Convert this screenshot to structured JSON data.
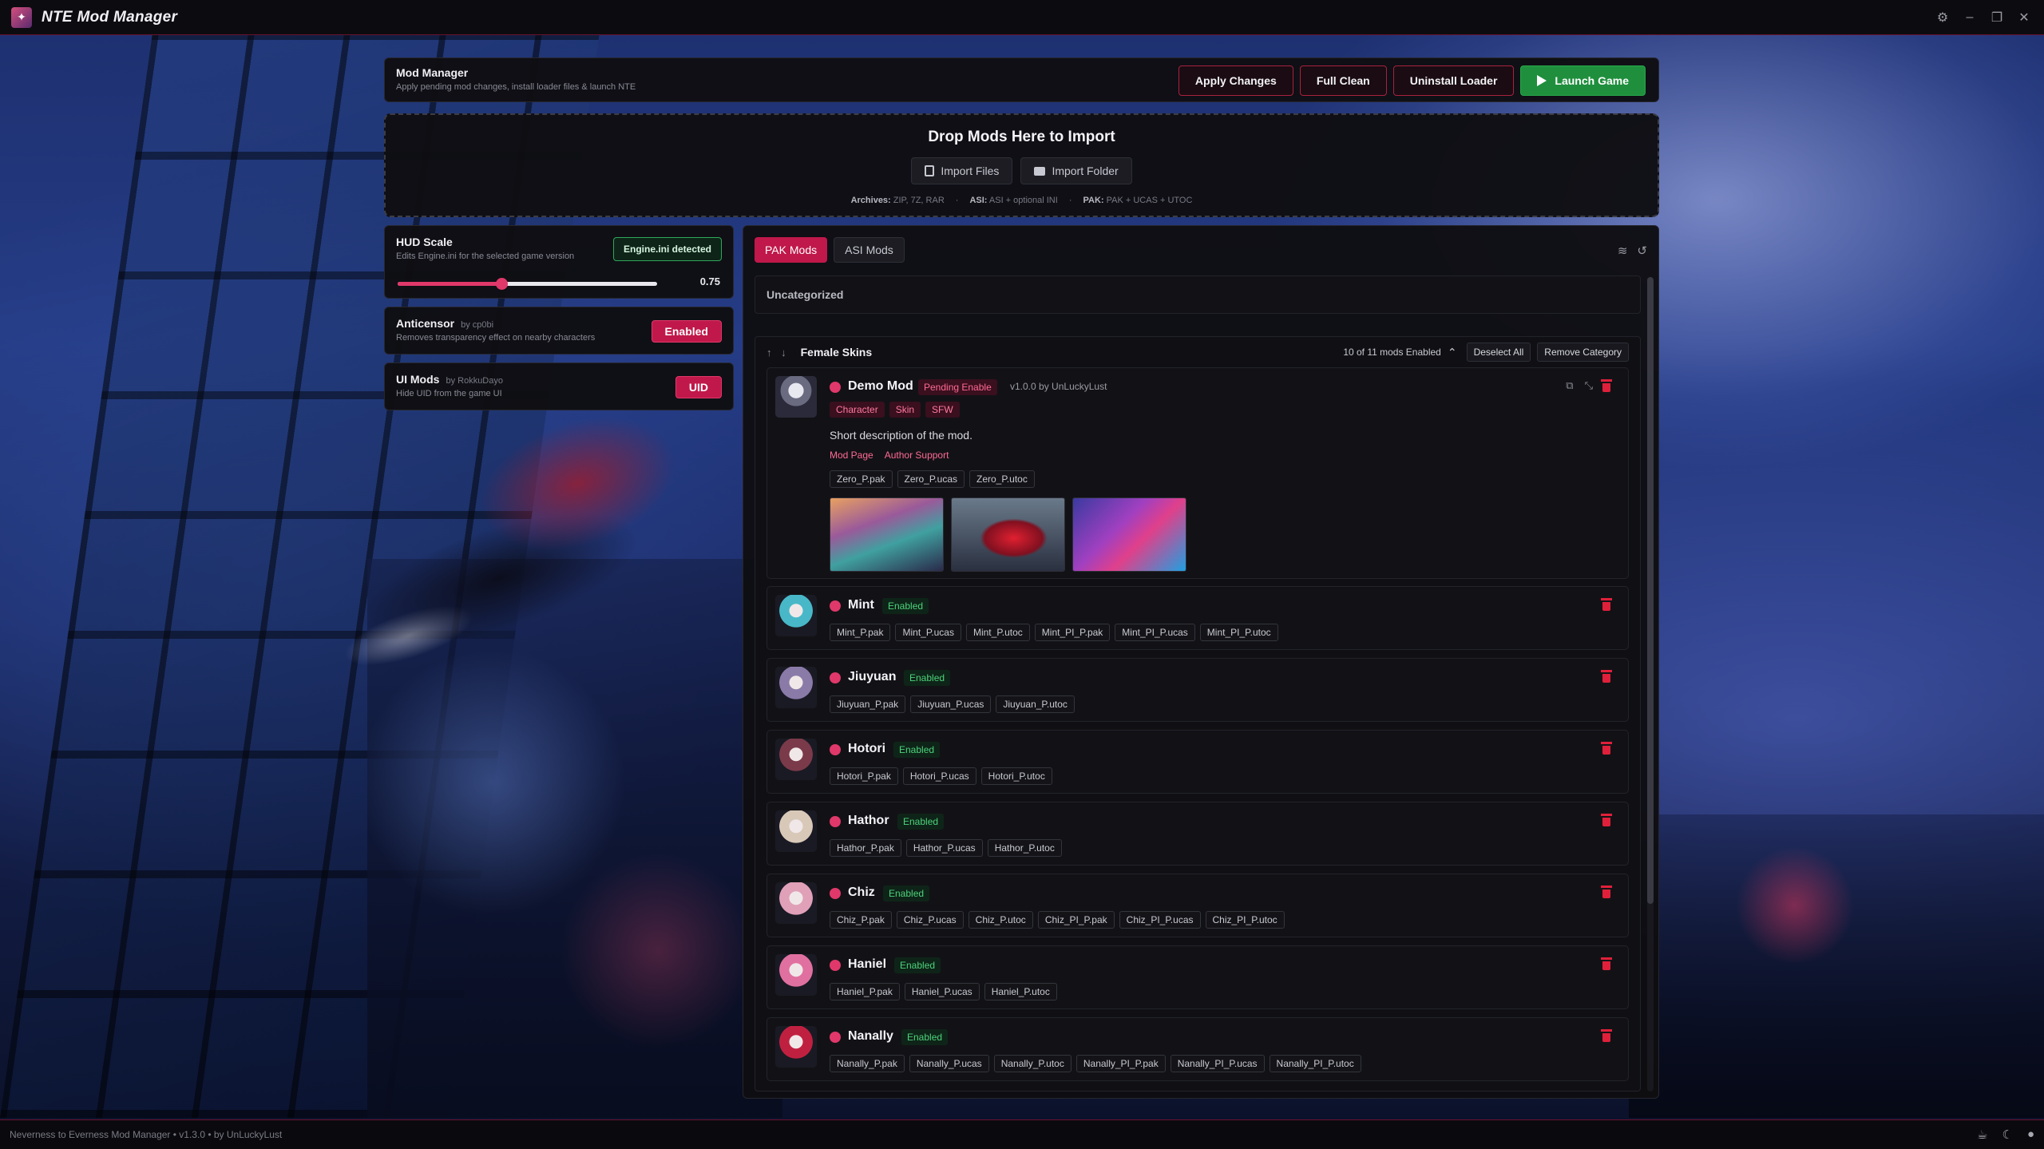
{
  "app": {
    "title": "NTE Mod Manager"
  },
  "header": {
    "title": "Mod Manager",
    "subtitle": "Apply pending mod changes, install loader files & launch NTE",
    "actions": {
      "apply": "Apply Changes",
      "clean": "Full Clean",
      "uninstall": "Uninstall Loader",
      "launch": "Launch Game"
    }
  },
  "drop": {
    "title": "Drop Mods Here to Import",
    "import_files": "Import Files",
    "import_folder": "Import Folder",
    "formats": [
      {
        "label": "Archives:",
        "value": "ZIP, 7Z, RAR"
      },
      {
        "label": "ASI:",
        "value": "ASI + optional INI"
      },
      {
        "label": "PAK:",
        "value": "PAK + UCAS + UTOC"
      }
    ]
  },
  "hud": {
    "title": "HUD Scale",
    "subtitle": "Edits Engine.ini for the selected game version",
    "badge": "Engine.ini detected",
    "value": "0.75",
    "fraction": 0.4
  },
  "anticensor": {
    "title": "Anticensor",
    "by": "by cp0bi",
    "subtitle": "Removes transparency effect on nearby characters",
    "button": "Enabled"
  },
  "uimods": {
    "title": "UI Mods",
    "by": "by RokkuDayo",
    "subtitle": "Hide UID from the game UI",
    "button": "UID"
  },
  "tabs": {
    "pak": "PAK Mods",
    "asi": "ASI Mods"
  },
  "uncategorized": "Uncategorized",
  "category": {
    "arrows": "↑ ↓",
    "name": "Female Skins",
    "count": "10 of 11 mods Enabled",
    "deselect": "Deselect All",
    "remove": "Remove Category"
  },
  "demo_mod": {
    "name": "Demo Mod",
    "status": "Pending Enable",
    "version": "v1.0.0",
    "author": "by UnLuckyLust",
    "tags": [
      "Character",
      "Skin",
      "SFW"
    ],
    "description": "Short description of the mod.",
    "links": [
      "Mod Page",
      "Author Support"
    ],
    "files": [
      "Zero_P.pak",
      "Zero_P.ucas",
      "Zero_P.utoc"
    ]
  },
  "mods": [
    {
      "name": "Mint",
      "status": "Enabled",
      "files": [
        "Mint_P.pak",
        "Mint_P.ucas",
        "Mint_P.utoc",
        "Mint_PI_P.pak",
        "Mint_PI_P.ucas",
        "Mint_PI_P.utoc"
      ],
      "color": "#48b8c8"
    },
    {
      "name": "Jiuyuan",
      "status": "Enabled",
      "files": [
        "Jiuyuan_P.pak",
        "Jiuyuan_P.ucas",
        "Jiuyuan_P.utoc"
      ],
      "color": "#8a7aa8"
    },
    {
      "name": "Hotori",
      "status": "Enabled",
      "files": [
        "Hotori_P.pak",
        "Hotori_P.ucas",
        "Hotori_P.utoc"
      ],
      "color": "#7a3a4a"
    },
    {
      "name": "Hathor",
      "status": "Enabled",
      "files": [
        "Hathor_P.pak",
        "Hathor_P.ucas",
        "Hathor_P.utoc"
      ],
      "color": "#d8c8b8"
    },
    {
      "name": "Chiz",
      "status": "Enabled",
      "files": [
        "Chiz_P.pak",
        "Chiz_P.ucas",
        "Chiz_P.utoc",
        "Chiz_PI_P.pak",
        "Chiz_PI_P.ucas",
        "Chiz_PI_P.utoc"
      ],
      "color": "#e0a0b8"
    },
    {
      "name": "Haniel",
      "status": "Enabled",
      "files": [
        "Haniel_P.pak",
        "Haniel_P.ucas",
        "Haniel_P.utoc"
      ],
      "color": "#e070a0"
    },
    {
      "name": "Nanally",
      "status": "Enabled",
      "files": [
        "Nanally_P.pak",
        "Nanally_P.ucas",
        "Nanally_P.utoc",
        "Nanally_PI_P.pak",
        "Nanally_PI_P.ucas",
        "Nanally_PI_P.utoc"
      ],
      "color": "#c02040"
    }
  ],
  "status_bar": {
    "text": "Neverness to Everness Mod Manager • v1.3.0 • by UnLuckyLust"
  },
  "icons": [
    "app-logo-icon",
    "gear-icon",
    "minimize-icon",
    "maximize-icon",
    "close-icon",
    "layers-icon",
    "history-icon",
    "copy-icon",
    "unlink-icon",
    "trash-icon",
    "coffee-icon",
    "moon-icon",
    "github-icon"
  ],
  "colors": {
    "accent": "#c0184a",
    "success": "#1f8f3d",
    "enabled_text": "#4ed27a"
  }
}
